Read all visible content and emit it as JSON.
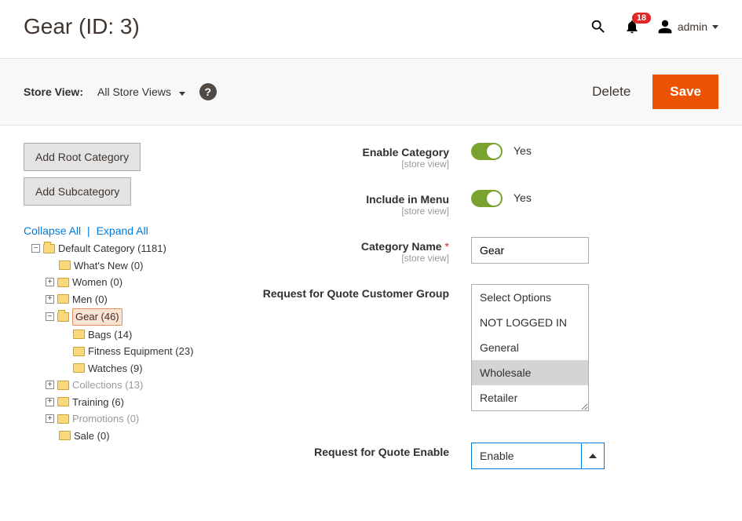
{
  "header": {
    "page_title": "Gear (ID: 3)",
    "notifications_count": "18",
    "admin_user": "admin"
  },
  "toolbar": {
    "store_view_label": "Store View:",
    "store_view_value": "All Store Views",
    "delete_label": "Delete",
    "save_label": "Save"
  },
  "sidebar": {
    "add_root": "Add Root Category",
    "add_sub": "Add Subcategory",
    "collapse_all": "Collapse All",
    "expand_all": "Expand All",
    "tree": {
      "root": "Default Category (1181)",
      "whats_new": "What's New (0)",
      "women": "Women (0)",
      "men": "Men (0)",
      "gear": "Gear (46)",
      "bags": "Bags (14)",
      "fitness": "Fitness Equipment (23)",
      "watches": "Watches (9)",
      "collections": "Collections (13)",
      "training": "Training (6)",
      "promotions": "Promotions (0)",
      "sale": "Sale (0)"
    }
  },
  "form": {
    "enable_category": {
      "label": "Enable Category",
      "scope": "[store view]",
      "value_text": "Yes"
    },
    "include_in_menu": {
      "label": "Include in Menu",
      "scope": "[store view]",
      "value_text": "Yes"
    },
    "category_name": {
      "label": "Category Name",
      "scope": "[store view]",
      "value": "Gear"
    },
    "rfq_group": {
      "label": "Request for Quote Customer Group",
      "options": [
        "Select Options",
        "NOT LOGGED IN",
        "General",
        "Wholesale",
        "Retailer"
      ],
      "selected": "Wholesale"
    },
    "rfq_enable": {
      "label": "Request for Quote Enable",
      "value": "Enable"
    }
  }
}
